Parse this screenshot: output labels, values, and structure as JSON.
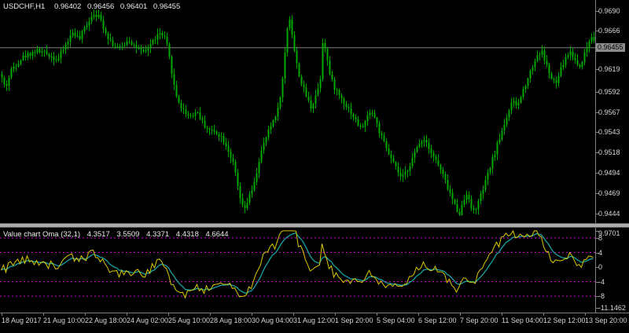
{
  "header": {
    "symbol": "USDCHF,H1",
    "open": "0.96402",
    "high": "0.96456",
    "low": "0.96401",
    "close": "0.96455"
  },
  "colors": {
    "background": "#000000",
    "axis_line": "#808080",
    "axis_text": "#D6D6D6",
    "splitter": "#ABABAB"
  },
  "chart_data": [
    {
      "type": "candlestick",
      "title": "USDCHF,H1",
      "bid": 0.96455,
      "bid_label": "0.96455",
      "ylim": [
        0.9432,
        0.9702
      ],
      "num_candles": 252,
      "seed": 42,
      "candle_color": "#00A800",
      "bid_line_color": "#808080",
      "y_axis_ticks": [
        {
          "label": "0.9690",
          "value": 0.969
        },
        {
          "label": "0.9666",
          "value": 0.9666
        },
        {
          "label": "0.9619",
          "value": 0.9619
        },
        {
          "label": "0.9592",
          "value": 0.9592
        },
        {
          "label": "0.9567",
          "value": 0.9567
        },
        {
          "label": "0.9543",
          "value": 0.9543
        },
        {
          "label": "0.9518",
          "value": 0.9518
        },
        {
          "label": "0.9494",
          "value": 0.9494
        },
        {
          "label": "0.9469",
          "value": 0.9469
        },
        {
          "label": "0.9444",
          "value": 0.9444
        }
      ],
      "x_axis_labels": [
        "18 Aug 2017",
        "21 Aug 10:00",
        "22 Aug 18:00",
        "24 Aug 02:00",
        "25 Aug 10:00",
        "28 Aug 18:00",
        "30 Aug 04:00",
        "31 Aug 12:00",
        "1 Sep 20:00",
        "5 Sep 04:00",
        "6 Sep 12:00",
        "7 Sep 20:00",
        "11 Sep 04:00",
        "12 Sep 12:00",
        "13 Sep 20:00"
      ],
      "price_path": [
        [
          0,
          0.9613
        ],
        [
          6,
          0.9596
        ],
        [
          14,
          0.962
        ],
        [
          28,
          0.9634
        ],
        [
          45,
          0.9642
        ],
        [
          60,
          0.9638
        ],
        [
          72,
          0.963
        ],
        [
          82,
          0.9648
        ],
        [
          92,
          0.9665
        ],
        [
          100,
          0.9655
        ],
        [
          108,
          0.9672
        ],
        [
          118,
          0.9688
        ],
        [
          126,
          0.9682
        ],
        [
          134,
          0.9663
        ],
        [
          142,
          0.965
        ],
        [
          152,
          0.9644
        ],
        [
          162,
          0.9656
        ],
        [
          172,
          0.9646
        ],
        [
          182,
          0.9638
        ],
        [
          192,
          0.9652
        ],
        [
          202,
          0.9663
        ],
        [
          210,
          0.9655
        ],
        [
          216,
          0.9625
        ],
        [
          222,
          0.959
        ],
        [
          230,
          0.9572
        ],
        [
          240,
          0.9562
        ],
        [
          250,
          0.9568
        ],
        [
          258,
          0.9552
        ],
        [
          266,
          0.9545
        ],
        [
          274,
          0.9543
        ],
        [
          282,
          0.9536
        ],
        [
          290,
          0.952
        ],
        [
          297,
          0.95
        ],
        [
          303,
          0.9468
        ],
        [
          309,
          0.9446
        ],
        [
          315,
          0.9462
        ],
        [
          322,
          0.9478
        ],
        [
          330,
          0.9515
        ],
        [
          338,
          0.9538
        ],
        [
          346,
          0.9556
        ],
        [
          353,
          0.9572
        ],
        [
          359,
          0.961
        ],
        [
          364,
          0.9668
        ],
        [
          368,
          0.9683
        ],
        [
          372,
          0.965
        ],
        [
          377,
          0.9622
        ],
        [
          383,
          0.96
        ],
        [
          389,
          0.9586
        ],
        [
          395,
          0.9572
        ],
        [
          401,
          0.959
        ],
        [
          406,
          0.9602
        ],
        [
          410,
          0.966
        ],
        [
          414,
          0.9638
        ],
        [
          419,
          0.961
        ],
        [
          425,
          0.9596
        ],
        [
          432,
          0.9586
        ],
        [
          439,
          0.9576
        ],
        [
          446,
          0.9566
        ],
        [
          452,
          0.9556
        ],
        [
          458,
          0.9547
        ],
        [
          464,
          0.9556
        ],
        [
          470,
          0.957
        ],
        [
          476,
          0.956
        ],
        [
          482,
          0.9542
        ],
        [
          489,
          0.9526
        ],
        [
          496,
          0.9511
        ],
        [
          503,
          0.9498
        ],
        [
          510,
          0.9486
        ],
        [
          517,
          0.9497
        ],
        [
          524,
          0.9512
        ],
        [
          531,
          0.9527
        ],
        [
          537,
          0.9536
        ],
        [
          543,
          0.9529
        ],
        [
          549,
          0.9516
        ],
        [
          556,
          0.9504
        ],
        [
          563,
          0.9489
        ],
        [
          570,
          0.9472
        ],
        [
          577,
          0.9455
        ],
        [
          583,
          0.9444
        ],
        [
          589,
          0.946
        ],
        [
          594,
          0.9472
        ],
        [
          599,
          0.9446
        ],
        [
          604,
          0.945
        ],
        [
          610,
          0.9464
        ],
        [
          617,
          0.9484
        ],
        [
          624,
          0.9505
        ],
        [
          631,
          0.9526
        ],
        [
          638,
          0.9546
        ],
        [
          645,
          0.9566
        ],
        [
          651,
          0.958
        ],
        [
          657,
          0.9574
        ],
        [
          663,
          0.959
        ],
        [
          669,
          0.9606
        ],
        [
          676,
          0.9622
        ],
        [
          682,
          0.9636
        ],
        [
          688,
          0.9641
        ],
        [
          694,
          0.9625
        ],
        [
          700,
          0.9608
        ],
        [
          706,
          0.9601
        ],
        [
          712,
          0.9618
        ],
        [
          718,
          0.9632
        ],
        [
          724,
          0.9641
        ],
        [
          730,
          0.9631
        ],
        [
          736,
          0.9621
        ],
        [
          742,
          0.9637
        ],
        [
          748,
          0.9652
        ],
        [
          753,
          0.9663
        ],
        [
          757,
          0.96455
        ]
      ]
    },
    {
      "type": "line",
      "title": "Value chart Oma (32,1)",
      "values": [
        "4.3517",
        "3.5509",
        "4.3371",
        "4.4318",
        "4.6644"
      ],
      "levels": [
        8,
        4,
        -4,
        -8
      ],
      "level_color": "#D000D0",
      "max": 9.9701,
      "min": -11.1462,
      "series": [
        {
          "name": "value-chart",
          "color": "#DCCB00"
        },
        {
          "name": "oma",
          "color": "#17A2A2"
        }
      ],
      "y_axis_ticks": [
        {
          "label": "9.9701",
          "value": 9.9701
        },
        {
          "label": "8",
          "value": 8
        },
        {
          "label": "4",
          "value": 4
        },
        {
          "label": "0",
          "value": 0
        },
        {
          "label": "-4",
          "value": -4
        },
        {
          "label": "-8",
          "value": -8
        },
        {
          "label": "-11.1462",
          "value": -11.1462
        }
      ]
    }
  ]
}
